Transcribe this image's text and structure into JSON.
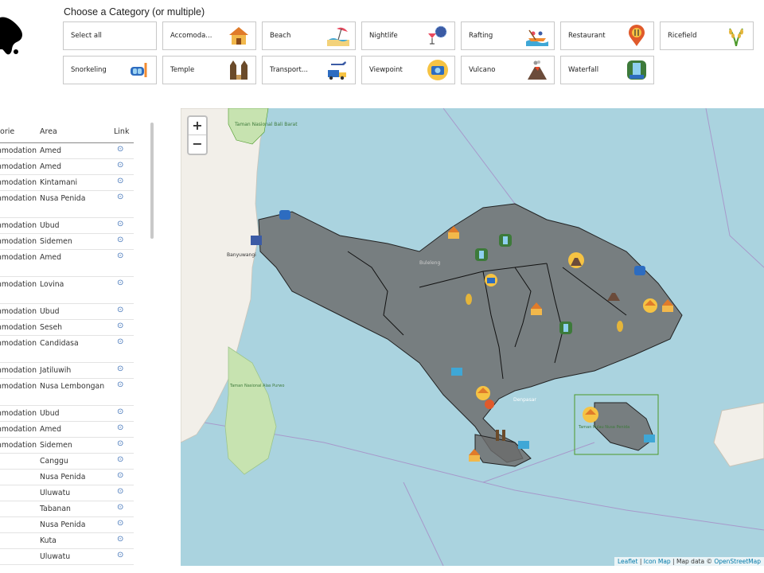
{
  "filter": {
    "title": "Choose a Category (or multiple)",
    "buttons": [
      {
        "label": "Select all",
        "icon": ""
      },
      {
        "label": "Accomoda...",
        "icon": "hut-icon"
      },
      {
        "label": "Beach",
        "icon": "beach-umbrella-icon"
      },
      {
        "label": "Nightlife",
        "icon": "disco-ball-icon"
      },
      {
        "label": "Rafting",
        "icon": "rafting-boat-icon"
      },
      {
        "label": "Restaurant",
        "icon": "restaurant-pin-icon"
      },
      {
        "label": "Ricefield",
        "icon": "rice-plant-icon"
      },
      {
        "label": "Snorkeling",
        "icon": "snorkel-mask-icon"
      },
      {
        "label": "Temple",
        "icon": "temple-gate-icon"
      },
      {
        "label": "Transport...",
        "icon": "plane-truck-icon"
      },
      {
        "label": "Viewpoint",
        "icon": "camera-icon"
      },
      {
        "label": "Vulcano",
        "icon": "volcano-icon"
      },
      {
        "label": "Waterfall",
        "icon": "waterfall-icon"
      }
    ]
  },
  "table": {
    "headers": {
      "category": "Categorie",
      "area": "Area",
      "link": "Link"
    },
    "rows": [
      {
        "category": "Accommodation",
        "area": "Amed",
        "link": "⊙",
        "h": 20
      },
      {
        "category": "Accommodation",
        "area": "Amed",
        "link": "⊙",
        "h": 20
      },
      {
        "category": "Accommodation",
        "area": "Kintamani",
        "link": "⊙",
        "h": 20
      },
      {
        "category": "Accommodation",
        "area": "Nusa Penida",
        "link": "⊙",
        "h": 34
      },
      {
        "category": "Accommodation",
        "area": "Ubud",
        "link": "⊙",
        "h": 20
      },
      {
        "category": "Accommodation",
        "area": "Sidemen",
        "link": "⊙",
        "h": 20
      },
      {
        "category": "Accommodation",
        "area": "Amed",
        "link": "⊙",
        "h": 34
      },
      {
        "category": "Accommodation",
        "area": "Lovina",
        "link": "⊙",
        "h": 34
      },
      {
        "category": "Accommodation",
        "area": "Ubud",
        "link": "⊙",
        "h": 20
      },
      {
        "category": "Accommodation",
        "area": "Seseh",
        "link": "⊙",
        "h": 20
      },
      {
        "category": "Accommodation",
        "area": "Candidasa",
        "link": "⊙",
        "h": 34
      },
      {
        "category": "Accommodation",
        "area": "Jatiluwih",
        "link": "⊙",
        "h": 20
      },
      {
        "category": "Accommodation",
        "area": "Nusa Lembongan",
        "link": "⊙",
        "h": 34
      },
      {
        "category": "Accommodation",
        "area": "Ubud",
        "link": "⊙",
        "h": 20
      },
      {
        "category": "Accommodation",
        "area": "Amed",
        "link": "⊙",
        "h": 20
      },
      {
        "category": "Accommodation",
        "area": "Sidemen",
        "link": "⊙",
        "h": 20
      },
      {
        "category": "",
        "area": "Canggu",
        "link": "⊙",
        "h": 20
      },
      {
        "category": "",
        "area": "Nusa Penida",
        "link": "⊙",
        "h": 20
      },
      {
        "category": "",
        "area": "Uluwatu",
        "link": "⊙",
        "h": 20
      },
      {
        "category": "",
        "area": "Tabanan",
        "link": "⊙",
        "h": 20
      },
      {
        "category": "",
        "area": "Nusa Penida",
        "link": "⊙",
        "h": 20
      },
      {
        "category": "",
        "area": "Kuta",
        "link": "⊙",
        "h": 20
      },
      {
        "category": "",
        "area": "Uluwatu",
        "link": "⊙",
        "h": 20
      }
    ]
  },
  "map": {
    "zoom_in": "+",
    "zoom_out": "−",
    "attribution_leaflet": "Leaflet",
    "attribution_sep1": " | ",
    "attribution_iconmap": "Icon Map",
    "attribution_sep2": " | Map data © ",
    "attribution_osm": "OpenStreetMap",
    "labels": {
      "taman_nasional": "Taman Nasional Bali Barat",
      "banyuwangi": "Banyuwangi",
      "buleleng": "Buleleng",
      "denpasar": "Denpasar",
      "nusa_penida_label": "Taman Pulau Nusa Penida",
      "alas_purwo": "Taman Nasional Alas Purwo"
    }
  }
}
